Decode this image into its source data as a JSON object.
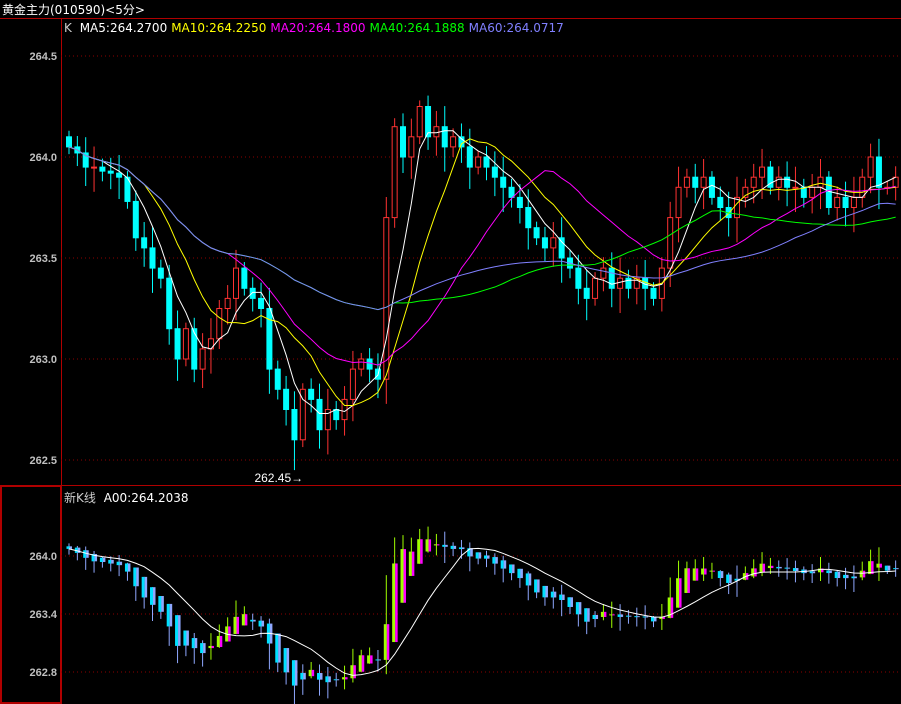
{
  "window": {
    "title": "黄金主力(010590)<5分>"
  },
  "main_panel": {
    "type_label": "K",
    "ma_labels": [
      {
        "text": "MA5:264.2700",
        "color": "#ffffff"
      },
      {
        "text": "MA10:264.2250",
        "color": "#ffff00"
      },
      {
        "text": "MA20:264.1800",
        "color": "#ff00ff"
      },
      {
        "text": "MA40:264.1888",
        "color": "#00ff00"
      },
      {
        "text": "MA60:264.0717",
        "color": "#8080ff"
      }
    ],
    "y_ticks": [
      "264.5",
      "264.0",
      "263.5",
      "263.0",
      "262.5"
    ],
    "low_marker": "262.45→"
  },
  "sub_panel": {
    "label": "新K线",
    "value_label": "A00:264.2038",
    "y_ticks": [
      "264.0",
      "263.4",
      "262.8"
    ]
  },
  "colors": {
    "up": "#ff3232",
    "down": "#00ffff",
    "grid": "#8b0000",
    "axis": "#b00000"
  },
  "chart_data": {
    "type": "candlestick",
    "title": "黄金主力(010590)<5分>",
    "ylim_main": [
      262.4,
      264.6
    ],
    "ylim_sub": [
      262.6,
      264.4
    ],
    "first_open": 264.1,
    "low_label_value": 262.45,
    "closes": [
      264.05,
      264.02,
      263.95,
      263.95,
      263.93,
      263.92,
      263.9,
      263.78,
      263.6,
      263.55,
      263.45,
      263.4,
      263.15,
      263.0,
      263.15,
      262.95,
      263.05,
      263.1,
      263.25,
      263.3,
      263.45,
      263.35,
      263.3,
      263.25,
      262.95,
      262.85,
      262.75,
      262.6,
      262.85,
      262.8,
      262.65,
      262.75,
      262.7,
      262.8,
      262.95,
      263.0,
      262.95,
      262.9,
      263.7,
      264.15,
      264.0,
      264.1,
      264.25,
      264.1,
      264.15,
      264.05,
      264.1,
      264.05,
      263.95,
      264.0,
      263.95,
      263.9,
      263.85,
      263.8,
      263.75,
      263.65,
      263.6,
      263.55,
      263.6,
      263.5,
      263.45,
      263.35,
      263.3,
      263.4,
      263.45,
      263.35,
      263.4,
      263.35,
      263.4,
      263.35,
      263.3,
      263.45,
      263.7,
      263.85,
      263.9,
      263.85,
      263.9,
      263.8,
      263.75,
      263.7,
      263.8,
      263.85,
      263.9,
      263.95,
      263.85,
      263.9,
      263.85,
      263.85,
      263.8,
      263.85,
      263.9,
      263.75,
      263.8,
      263.75,
      263.8,
      263.9,
      264.0,
      263.85,
      263.85,
      263.9
    ]
  }
}
